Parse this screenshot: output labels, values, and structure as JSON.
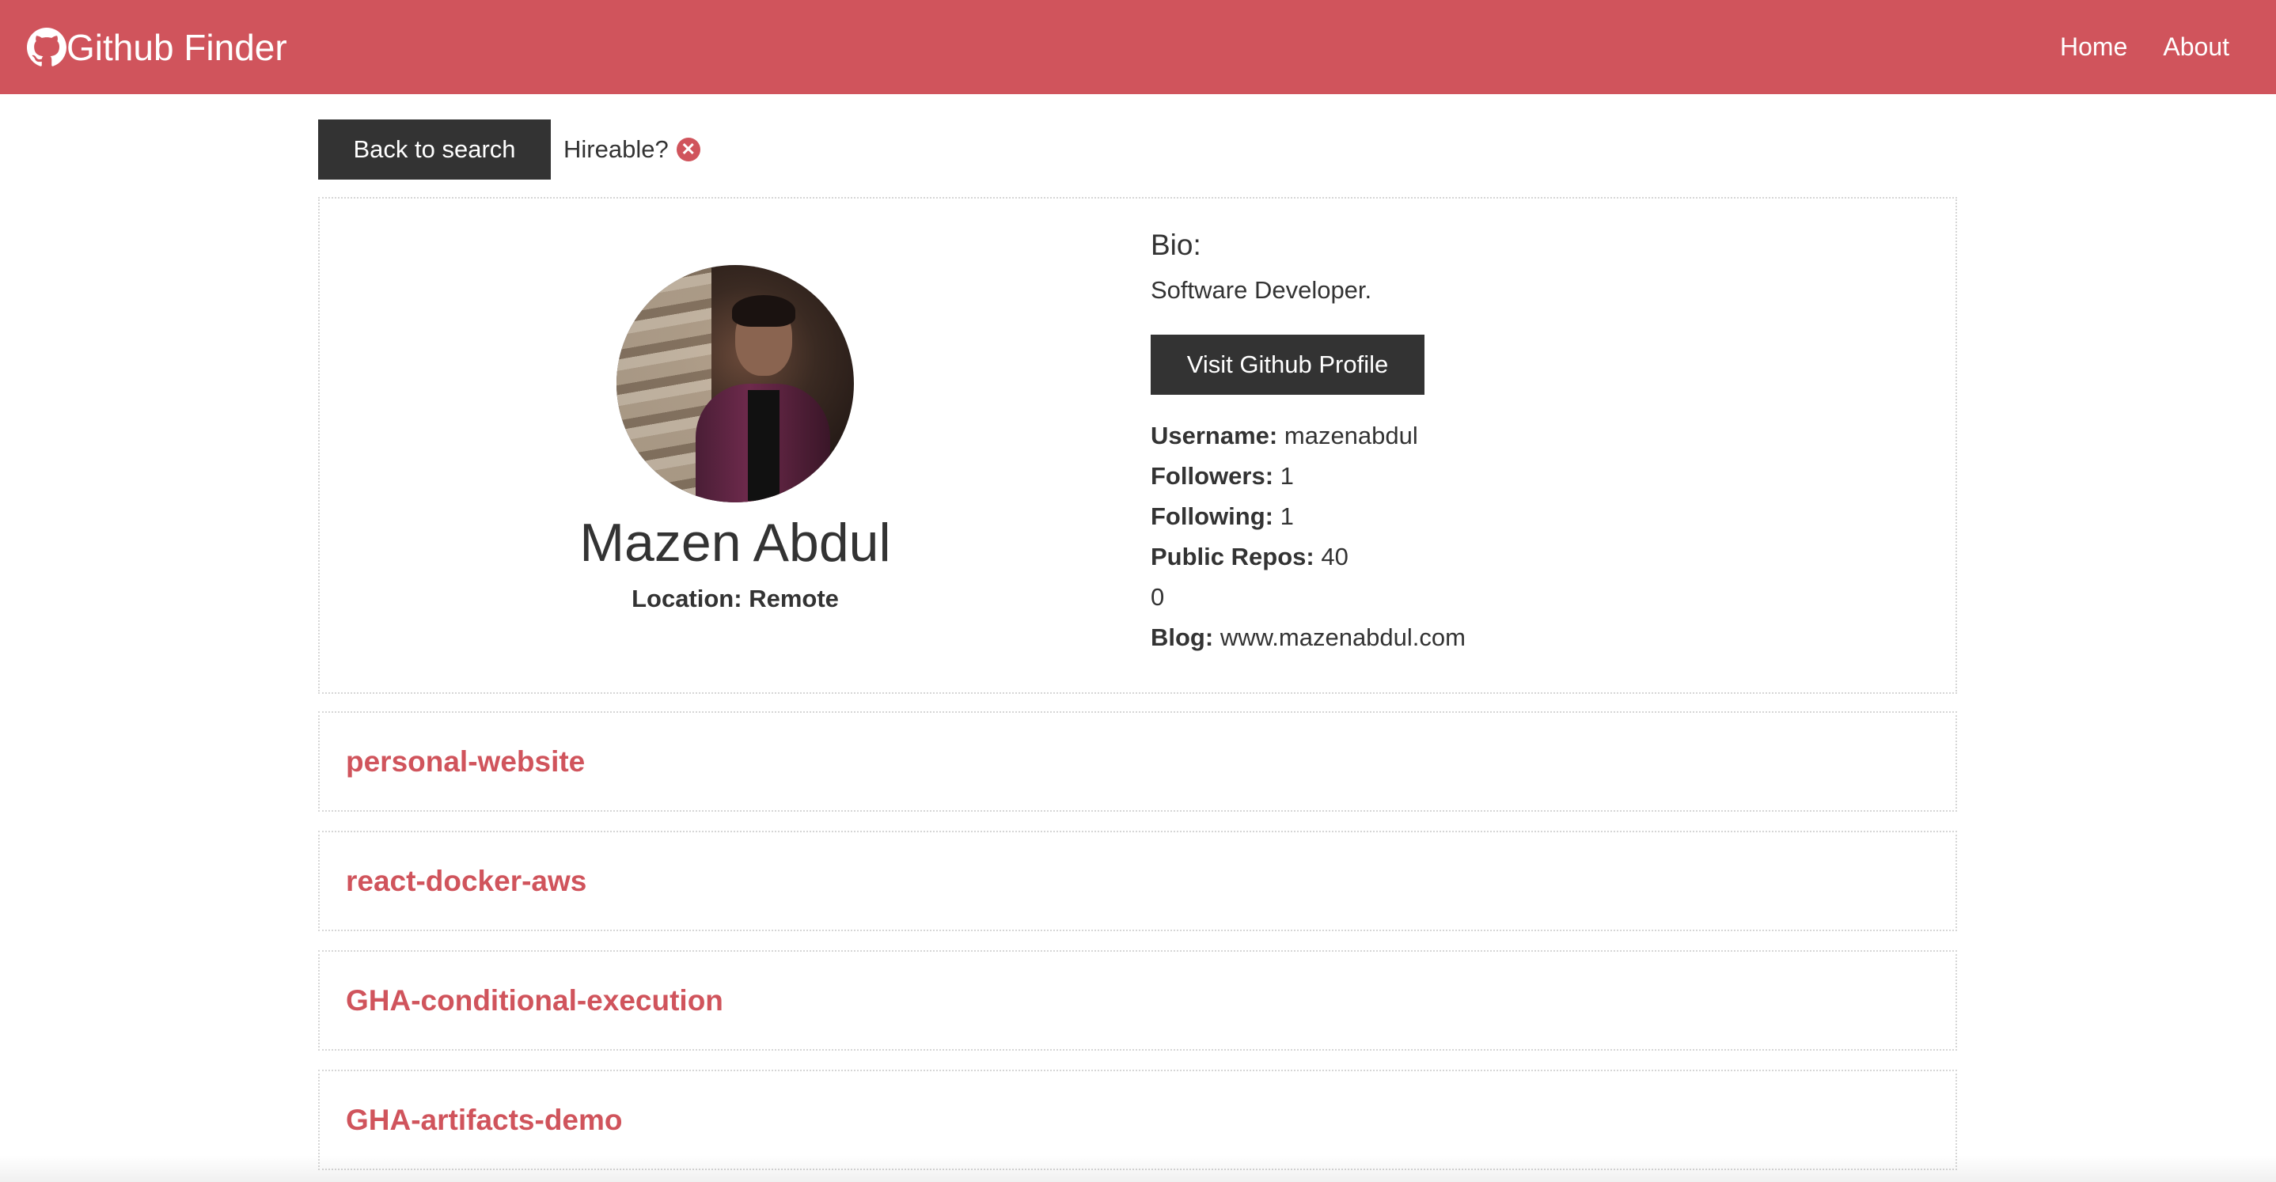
{
  "navbar": {
    "brand": "Github Finder",
    "brand_icon": "github-icon",
    "links": [
      {
        "label": "Home"
      },
      {
        "label": "About"
      }
    ],
    "color": "#d0545c"
  },
  "toolbar": {
    "back_label": "Back to search",
    "hireable_label": "Hireable?",
    "hireable_icon": "x-circle-icon"
  },
  "profile": {
    "name": "Mazen Abdul",
    "location_label": "Location:",
    "location": "Remote",
    "bio_title": "Bio:",
    "bio": "Software Developer.",
    "visit_label": "Visit Github Profile",
    "username_label": "Username:",
    "username": "mazenabdul",
    "followers_label": "Followers:",
    "followers": "1",
    "following_label": "Following:",
    "following": "1",
    "repos_label": "Public Repos:",
    "repos": "40",
    "gists": "0",
    "blog_label": "Blog:",
    "blog": "www.mazenabdul.com"
  },
  "repos": [
    {
      "name": "personal-website"
    },
    {
      "name": "react-docker-aws"
    },
    {
      "name": "GHA-conditional-execution"
    },
    {
      "name": "GHA-artifacts-demo"
    }
  ]
}
